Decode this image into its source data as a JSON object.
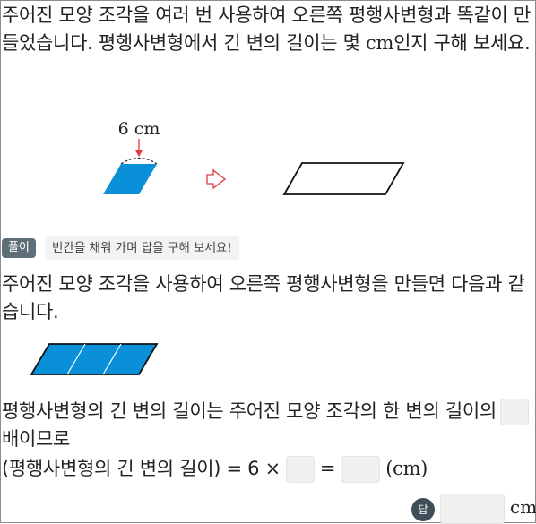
{
  "question": {
    "text1": "주어진 모양 조각을 여러 번 사용하여 오른쪽 평행사변형과 똑같이 만들었습니다. 평행사변형에서 긴 변의 길이는 몇 ",
    "unit": "cm",
    "text2": "인지 구해 보세요."
  },
  "figure1": {
    "measure_label": "6 cm"
  },
  "solution": {
    "badge": "풀이",
    "hint": "빈칸을 채워 가며 답을 구해 보세요!",
    "intro": "주어진 모양 조각을 사용하여 오른쪽 평행사변형을 만들면 다음과 같습니다.",
    "line1_a": "평행사변형의 긴 변의 길이는 주어진 모양 조각의 한 변의 길이의",
    "line1_b": "배이므로",
    "eq_left": "(평행사변형의 긴 변의 길이) = 6 ×",
    "eq_equals": "=",
    "eq_unit": "(cm)"
  },
  "answer": {
    "badge": "답",
    "unit": "cm"
  },
  "colors": {
    "fill_blue": "#0a90d8",
    "arrow_red": "#e03c3c",
    "badge_gray": "#5d6e76"
  }
}
